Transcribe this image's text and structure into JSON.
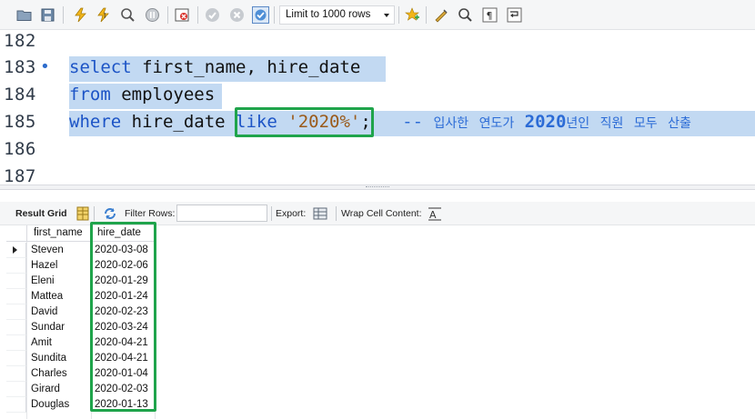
{
  "toolbar": {
    "limit_label": "Limit to 1000 rows",
    "icons": [
      "open-folder-icon",
      "save-icon",
      "execute-icon",
      "execute-current-icon",
      "explain-icon",
      "stop-icon",
      "toggle-error-icon",
      "commit-icon",
      "rollback-icon",
      "autocommit-icon",
      "bookmark-icon",
      "beautify-icon",
      "find-icon",
      "invisible-chars-icon",
      "wrap-icon"
    ]
  },
  "editor": {
    "lines": [
      {
        "num": "182",
        "text": ""
      },
      {
        "num": "183",
        "text": "select first_name, hire_date"
      },
      {
        "num": "184",
        "text": "from employees"
      },
      {
        "num": "185",
        "kw1": "where",
        "col": " hire_date ",
        "kw2": "like",
        "str": "'2020%'",
        "semi": ";",
        "comment_dash": "--",
        "comment_ko1": "입사한",
        "comment_ko2": "연도가",
        "comment_year": "2020",
        "comment_ko3": "년인",
        "comment_ko4": "직원",
        "comment_ko5": "모두",
        "comment_ko6": "산출"
      },
      {
        "num": "186",
        "text": ""
      },
      {
        "num": "187",
        "text": ""
      }
    ],
    "active_dot": "•"
  },
  "results": {
    "result_grid_label": "Result Grid",
    "filter_rows_label": "Filter Rows:",
    "filter_value": "",
    "export_label": "Export:",
    "wrap_label": "Wrap Cell Content:",
    "columns": [
      "first_name",
      "hire_date"
    ],
    "rows": [
      [
        "Steven",
        "2020-03-08"
      ],
      [
        "Hazel",
        "2020-02-06"
      ],
      [
        "Eleni",
        "2020-01-29"
      ],
      [
        "Mattea",
        "2020-01-24"
      ],
      [
        "David",
        "2020-02-23"
      ],
      [
        "Sundar",
        "2020-03-24"
      ],
      [
        "Amit",
        "2020-04-21"
      ],
      [
        "Sundita",
        "2020-04-21"
      ],
      [
        "Charles",
        "2020-01-04"
      ],
      [
        "Girard",
        "2020-02-03"
      ],
      [
        "Douglas",
        "2020-01-13"
      ]
    ]
  },
  "colors": {
    "highlight": "#c2d9f2",
    "keyword": "#1c54c6",
    "string": "#9a5a1a",
    "annotation": "#1fa44b"
  }
}
